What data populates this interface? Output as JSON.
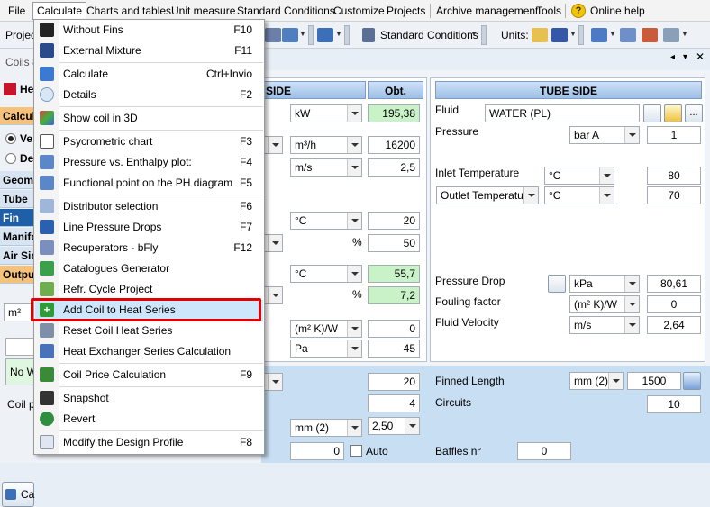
{
  "menubar": {
    "file": "File",
    "calculate": "Calculate",
    "charts": "Charts and tables",
    "unit": "Unit measure",
    "standard": "Standard Conditions",
    "customize": "Customize",
    "projects": "Projects",
    "archive": "Archive management",
    "tools": "Tools",
    "help": "Online help"
  },
  "toolbar": {
    "project_label": "Projec",
    "standard_conditions": "Standard Conditions",
    "units_label": "Units:"
  },
  "left": {
    "coils_tab": "Coils 8",
    "he_label": "He",
    "calcul": "Calcul",
    "ve": "Ve",
    "de": "De",
    "geom": "Geom",
    "tube": "Tube",
    "fin": "Fin",
    "manif": "Manifo",
    "air": "Air Sid",
    "output": "Outpu",
    "unit_m2": "m²",
    "no_wa": "No Wa",
    "coil_pr": "Coil pr",
    "calc_btn": "Ca"
  },
  "air_side": {
    "header": "SIDE",
    "obt_header": "Obt.",
    "rows": [
      {
        "unit": "kW",
        "value": "195,38"
      },
      {
        "unit": "m³/h",
        "value": "16200"
      },
      {
        "unit": "m/s",
        "value": "2,5"
      },
      {
        "unit": "°C",
        "value": "20"
      },
      {
        "unit": "%",
        "value": "50"
      },
      {
        "unit": "°C",
        "value": "55,7"
      },
      {
        "unit": "%",
        "value": "7,2"
      },
      {
        "unit": "(m² K)/W",
        "value": "0"
      },
      {
        "unit": "Pa",
        "value": "45"
      }
    ]
  },
  "tube_side": {
    "header": "TUBE SIDE",
    "fluid_label": "Fluid",
    "fluid_value": "WATER (PL)",
    "pressure_label": "Pressure",
    "pressure_unit": "bar A",
    "pressure_value": "1",
    "inlet_label": "Inlet Temperature",
    "inlet_unit": "°C",
    "inlet_value": "80",
    "outlet_label": "Outlet Temperature",
    "outlet_unit": "°C",
    "outlet_value": "70",
    "pd_label": "Pressure Drop",
    "pd_unit": "kPa",
    "pd_value": "80,61",
    "fouling_label": "Fouling factor",
    "fouling_unit": "(m² K)/W",
    "fouling_value": "0",
    "velocity_label": "Fluid Velocity",
    "velocity_unit": "m/s",
    "velocity_value": "2,64",
    "more_btn": "..."
  },
  "geometry": {
    "val1": "20",
    "val2": "4",
    "mm_unit": "mm (2)",
    "mm_value": "2,50",
    "val3": "0",
    "auto_label": "Auto",
    "finned_label": "Finned Length",
    "finned_unit": "mm (2)",
    "finned_value": "1500",
    "circuits_label": "Circuits",
    "circuits_value": "10",
    "baffles_label": "Baffles n°",
    "baffles_value": "0"
  },
  "dropdown": {
    "items": [
      {
        "label": "Without Fins",
        "shortcut": "F10"
      },
      {
        "label": "External Mixture",
        "shortcut": "F11"
      },
      {
        "label": "Calculate",
        "shortcut": "Ctrl+Invio"
      },
      {
        "label": "Details",
        "shortcut": "F2"
      },
      {
        "label": "Show coil in 3D",
        "shortcut": ""
      },
      {
        "label": "Psycrometric chart",
        "shortcut": "F3"
      },
      {
        "label": "Pressure vs. Enthalpy plot:",
        "shortcut": "F4"
      },
      {
        "label": "Functional point on the PH diagram",
        "shortcut": "F5"
      },
      {
        "label": "Distributor selection",
        "shortcut": "F6"
      },
      {
        "label": "Line Pressure Drops",
        "shortcut": "F7"
      },
      {
        "label": "Recuperators - bFly",
        "shortcut": "F12"
      },
      {
        "label": "Catalogues Generator",
        "shortcut": ""
      },
      {
        "label": "Refr. Cycle Project",
        "shortcut": ""
      },
      {
        "label": "Add Coil to Heat Series",
        "shortcut": ""
      },
      {
        "label": "Reset Coil Heat Series",
        "shortcut": ""
      },
      {
        "label": "Heat Exchanger Series Calculation",
        "shortcut": ""
      },
      {
        "label": "Coil Price Calculation",
        "shortcut": "F9"
      },
      {
        "label": "Snapshot",
        "shortcut": ""
      },
      {
        "label": "Revert",
        "shortcut": ""
      },
      {
        "label": "Modify the Design Profile",
        "shortcut": "F8"
      }
    ]
  },
  "colors": {
    "highlight": "#cde6fb",
    "red_box": "#e00000",
    "green_field": "#c9f2c9",
    "header_blue": "#9dbfe6"
  }
}
